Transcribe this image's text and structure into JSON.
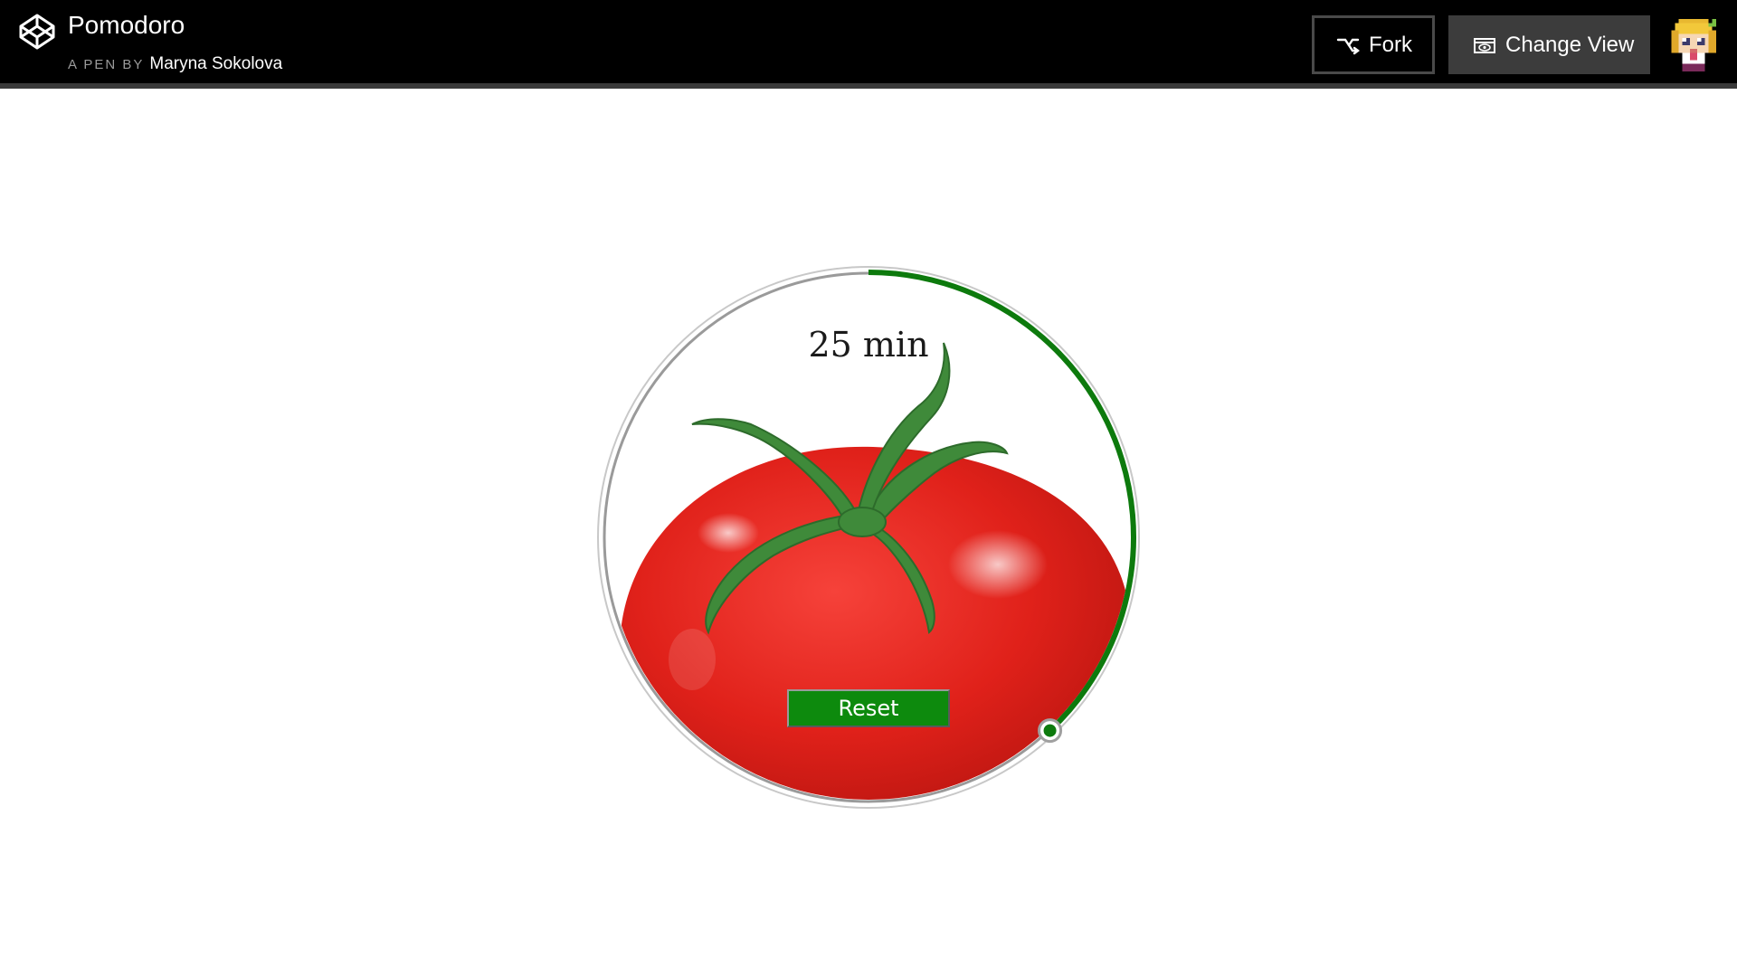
{
  "header": {
    "title": "Pomodoro",
    "by_label": "A PEN BY",
    "author": "Maryna Sokolova",
    "fork_label": "Fork",
    "change_view_label": "Change View"
  },
  "icons": {
    "logo": "codepen-logo-icon",
    "fork": "fork-icon",
    "change_view": "eye-icon",
    "avatar": "pixel-avatar"
  },
  "timer": {
    "display": "25 min",
    "reset_label": "Reset",
    "progress": 0.38
  },
  "colors": {
    "topbar": "#000000",
    "progress_arc": "#0d7a0d",
    "reset_button": "#0d8a0d",
    "tomato": "#e8221b",
    "stem": "#3f8a3a"
  }
}
